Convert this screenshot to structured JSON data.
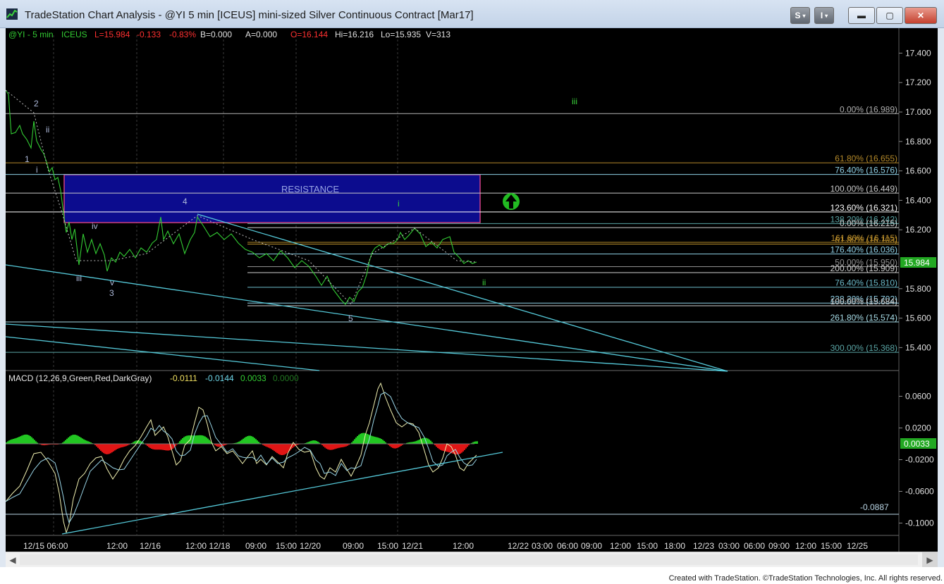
{
  "window": {
    "title": "TradeStation Chart Analysis - @YI 5 min [ICEUS] mini-sized Silver Continuous Contract [Mar17]",
    "buttons": {
      "s": "S",
      "i": "I",
      "min": "▬",
      "max": "▢",
      "close": "✕"
    }
  },
  "header_bar": {
    "symbol": "@YI - 5 min",
    "exchange": "ICEUS",
    "last": "L=15.984",
    "change": "-0.133",
    "pct": "-0.83%",
    "bid": "B=0.000",
    "ask": "A=0.000",
    "open": "O=16.144",
    "high": "Hi=16.216",
    "low": "Lo=15.935",
    "volume": "V=313"
  },
  "price_axis": {
    "ticks": [
      "17.400",
      "17.200",
      "17.000",
      "16.800",
      "16.600",
      "16.400",
      "16.200",
      "15.800",
      "15.600",
      "15.400"
    ],
    "last_price": "15.984"
  },
  "macd": {
    "title": "MACD (12,26,9,Green,Red,DarkGray)",
    "macd_value": "-0.0111",
    "signal_value": "-0.0144",
    "hist_value": "0.0033",
    "zero_value": "0.0000",
    "axis_ticks": [
      "0.0600",
      "0.0200",
      "-0.0200",
      "-0.0600",
      "-0.1000"
    ],
    "level_label": "-0.0887",
    "last_badge": "0.0033"
  },
  "time_axis": {
    "labels": [
      "12/15 06:00",
      "12:00",
      "12/16",
      "12:00 12/18",
      "09:00",
      "15:00",
      "12/20",
      "09:00",
      "15:00",
      "12/21",
      "12:00",
      "12/22",
      "03:00",
      "06:00",
      "09:00",
      "12:00",
      "15:00",
      "18:00",
      "12/23",
      "03:00",
      "06:00",
      "09:00",
      "12:00",
      "15:00",
      "12/25"
    ]
  },
  "fib_levels": [
    {
      "text": "0.00% (16.989)",
      "price": 16.989,
      "color": "#b0b0b0"
    },
    {
      "text": "61.80% (16.655)",
      "price": 16.655,
      "color": "#b58a2a"
    },
    {
      "text": "76.40% (16.576)",
      "price": 16.576,
      "color": "#8fd0e6"
    },
    {
      "text": "100.00% (16.449)",
      "price": 16.449,
      "color": "#c8c8c8"
    },
    {
      "text": "123.60% (16.321)",
      "price": 16.321,
      "color": "#ffffff"
    },
    {
      "text": "138.20% (16.242)",
      "price": 16.242,
      "color": "#5aa5a5"
    },
    {
      "text": "0.00% (16.215)",
      "price": 16.215,
      "color": "#d0d0d0"
    },
    {
      "text": "161.80% (16.115)",
      "price": 16.115,
      "color": "#b58a2a"
    },
    {
      "text": "61.80% (16.103)",
      "price": 16.103,
      "color": "#b58a2a"
    },
    {
      "text": "176.40% (16.036)",
      "price": 16.036,
      "color": "#8fd0e6"
    },
    {
      "text": "50.00% (15.950)",
      "price": 15.95,
      "color": "#909090"
    },
    {
      "text": "200.00% (15.909)",
      "price": 15.909,
      "color": "#d0d0d0"
    },
    {
      "text": "76.40% (15.810)",
      "price": 15.81,
      "color": "#6bb8c8"
    },
    {
      "text": "238.20% (15.702)",
      "price": 15.702,
      "color": "#8fd0e6"
    },
    {
      "text": "100.00% (15.684)",
      "price": 15.684,
      "color": "#d0d0d0"
    },
    {
      "text": "261.80% (15.574)",
      "price": 15.574,
      "color": "#a8dde8"
    },
    {
      "text": "300.00% (15.368)",
      "price": 15.368,
      "color": "#5aa5a5"
    }
  ],
  "annotations": {
    "resistance": "RESISTANCE",
    "waves": [
      {
        "text": "2",
        "color": "#aebadb"
      },
      {
        "text": "ii",
        "color": "#aebadb"
      },
      {
        "text": "1",
        "color": "#aebadb"
      },
      {
        "text": "i",
        "color": "#aebadb"
      },
      {
        "text": "iv",
        "color": "#aebadb"
      },
      {
        "text": "iii",
        "color": "#aebadb"
      },
      {
        "text": "v",
        "color": "#aebadb"
      },
      {
        "text": "3",
        "color": "#aebadb"
      },
      {
        "text": "4",
        "color": "#aebadb"
      },
      {
        "text": "5",
        "color": "#aebadb"
      },
      {
        "text": "i",
        "color": "#3bd43b"
      },
      {
        "text": "ii",
        "color": "#3bd43b"
      },
      {
        "text": "iii",
        "color": "#3bd43b"
      }
    ]
  },
  "colors": {
    "background": "#000000",
    "price_line": "#33cc33",
    "macd_up": "#22c622",
    "macd_down": "#e01515",
    "trendline": "#55c9d9",
    "resistance_fill": "#0c0c8e",
    "resistance_border": "#d04080",
    "up_arrow": "#22bb22"
  },
  "footer": "Created with TradeStation. ©TradeStation Technologies, Inc. All rights reserved."
}
